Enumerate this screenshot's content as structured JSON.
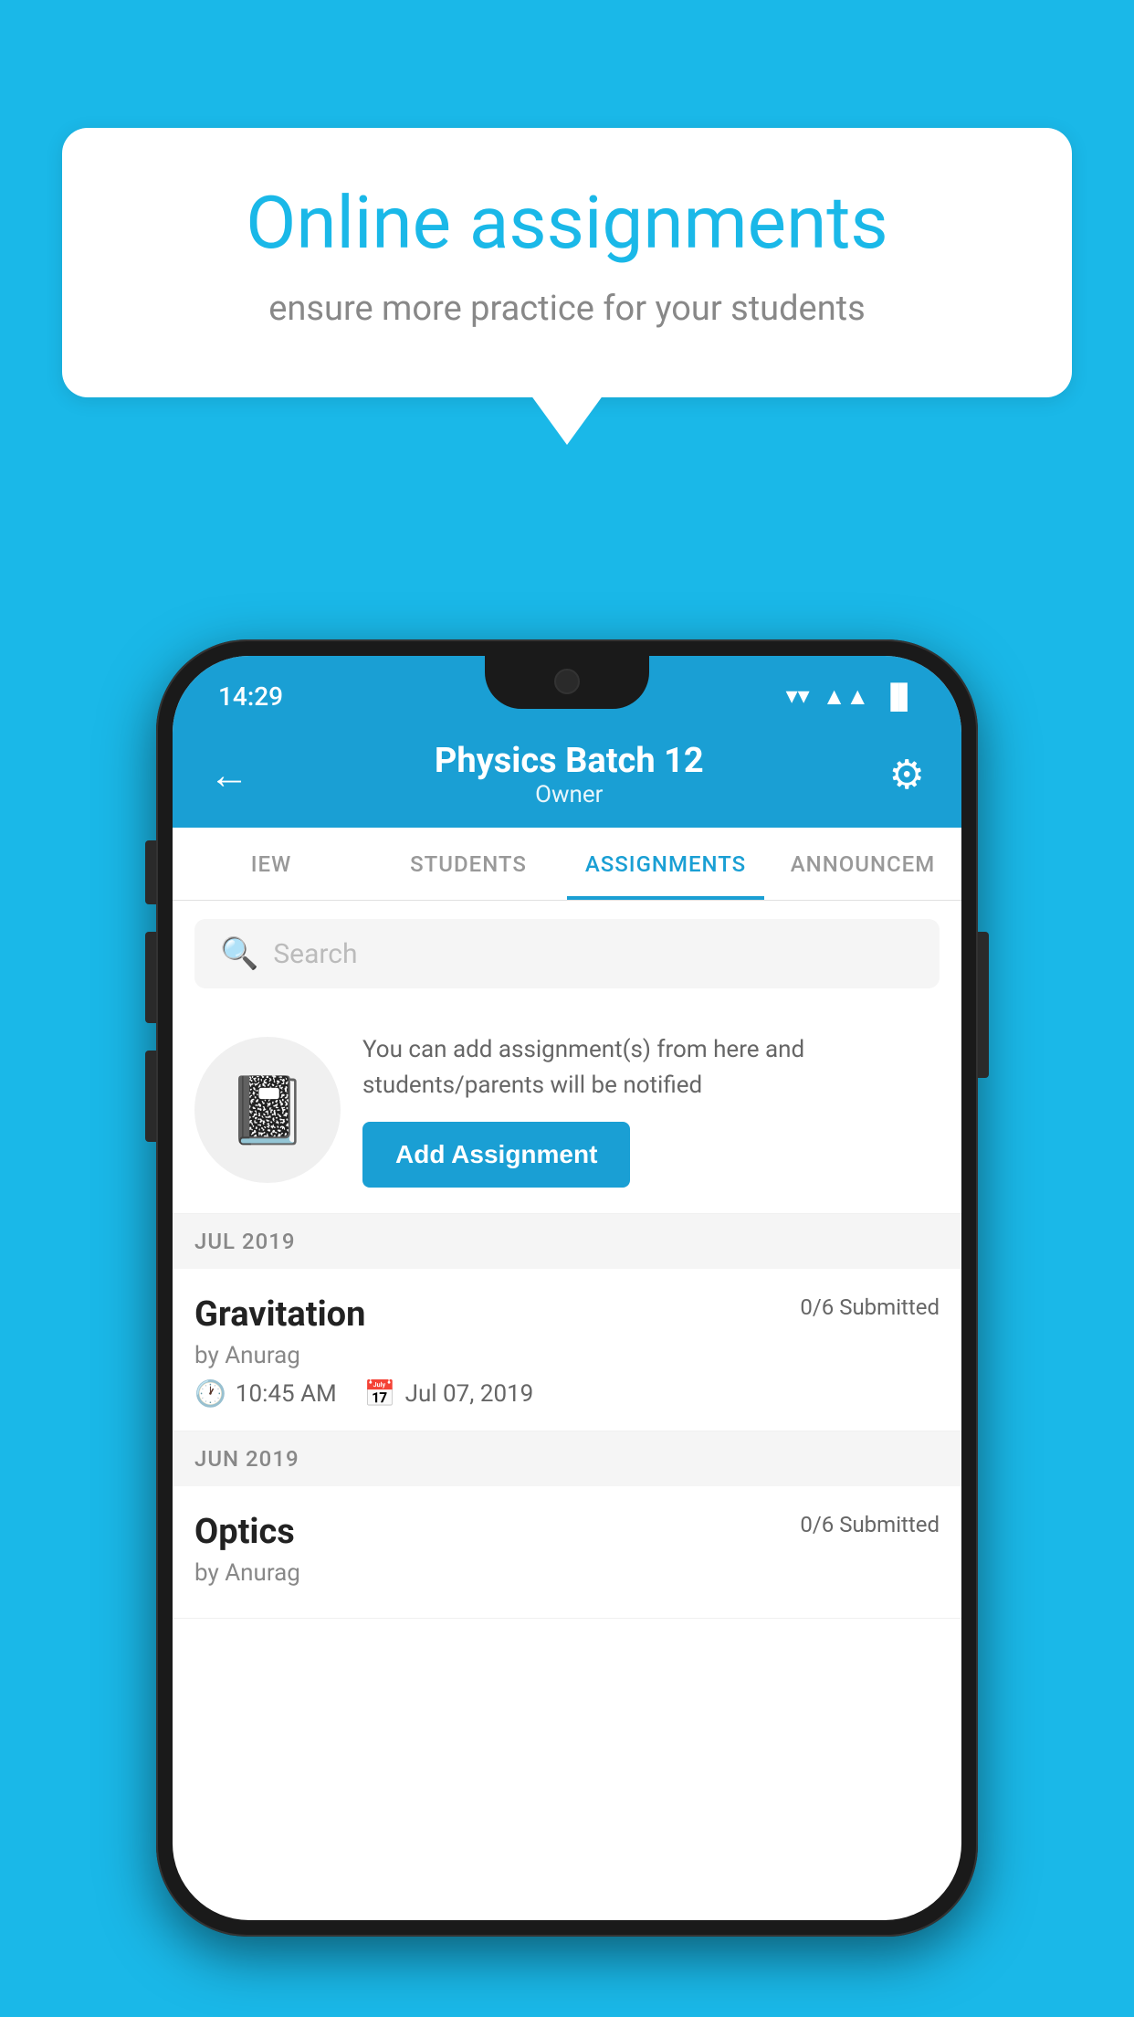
{
  "background_color": "#1ab8e8",
  "speech_bubble": {
    "title": "Online assignments",
    "subtitle": "ensure more practice for your students"
  },
  "phone": {
    "status_bar": {
      "time": "14:29",
      "wifi": "▼",
      "signal": "▲",
      "battery": "▐"
    },
    "header": {
      "title": "Physics Batch 12",
      "subtitle": "Owner",
      "back_label": "←",
      "settings_label": "⚙"
    },
    "tabs": [
      {
        "label": "IEW",
        "active": false
      },
      {
        "label": "STUDENTS",
        "active": false
      },
      {
        "label": "ASSIGNMENTS",
        "active": true
      },
      {
        "label": "ANNOUNCEM",
        "active": false
      }
    ],
    "search": {
      "placeholder": "Search"
    },
    "promo": {
      "description": "You can add assignment(s) from here and students/parents will be notified",
      "button_label": "Add Assignment"
    },
    "sections": [
      {
        "month": "JUL 2019",
        "assignments": [
          {
            "name": "Gravitation",
            "submitted": "0/6 Submitted",
            "by": "by Anurag",
            "time": "10:45 AM",
            "date": "Jul 07, 2019"
          }
        ]
      },
      {
        "month": "JUN 2019",
        "assignments": [
          {
            "name": "Optics",
            "submitted": "0/6 Submitted",
            "by": "by Anurag",
            "time": "",
            "date": ""
          }
        ]
      }
    ]
  }
}
